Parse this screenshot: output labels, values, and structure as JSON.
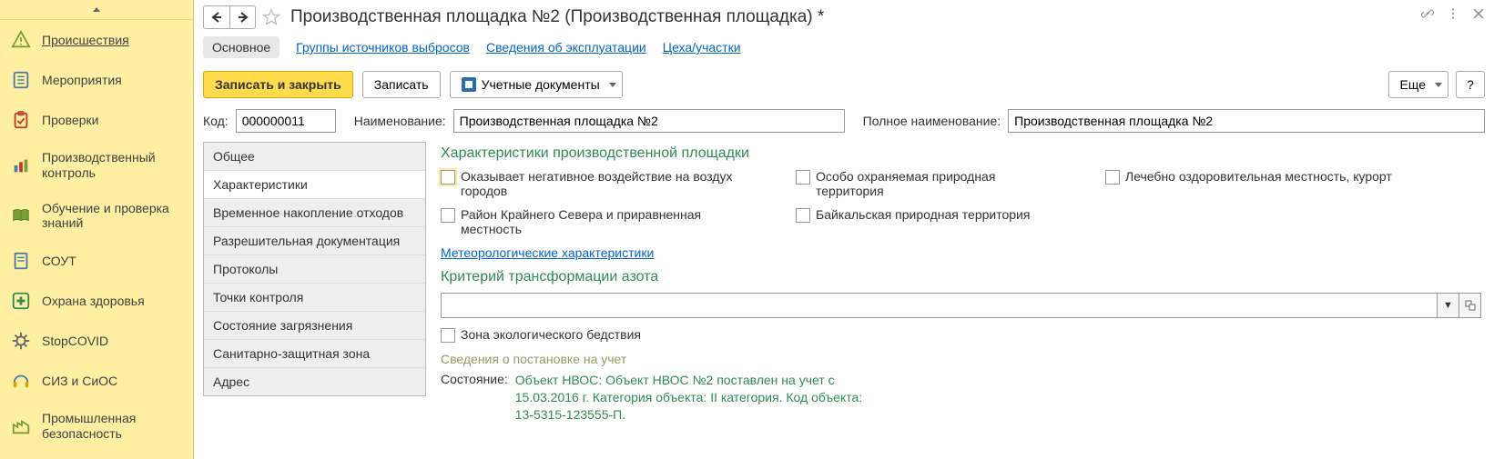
{
  "sidebar": {
    "items": [
      {
        "label": "Происшествия"
      },
      {
        "label": "Мероприятия"
      },
      {
        "label": "Проверки"
      },
      {
        "label": "Производственный контроль"
      },
      {
        "label": "Обучение и проверка знаний"
      },
      {
        "label": "СОУТ"
      },
      {
        "label": "Охрана здоровья"
      },
      {
        "label": "StopCOVID"
      },
      {
        "label": "СИЗ и СиОС"
      },
      {
        "label": "Промышленная безопасность"
      }
    ]
  },
  "header": {
    "title": "Производственная площадка №2 (Производственная площадка) *"
  },
  "tabs": [
    "Основное",
    "Группы источников выбросов",
    "Сведения об эксплуатации",
    "Цеха/участки"
  ],
  "toolbar": {
    "save_close": "Записать и закрыть",
    "save": "Записать",
    "docs": "Учетные документы",
    "more": "Еще",
    "help": "?"
  },
  "form": {
    "code_label": "Код:",
    "code_value": "000000011",
    "name_label": "Наименование:",
    "name_value": "Производственная площадка №2",
    "fullname_label": "Полное наименование:",
    "fullname_value": "Производственная площадка №2"
  },
  "vtabs": [
    "Общее",
    "Характеристики",
    "Временное накопление отходов",
    "Разрешительная документация",
    "Протоколы",
    "Точки контроля",
    "Состояние загрязнения",
    "Санитарно-защитная зона",
    "Адрес"
  ],
  "detail": {
    "section1": "Характеристики производственной площадки",
    "checks": {
      "c1": "Оказывает негативное воздействие на воздух городов",
      "c2": "Особо охраняемая природная территория",
      "c3": "Лечебно оздоровительная местность, курорт",
      "c4": "Район Крайнего Севера и приравненная местность",
      "c5": "Байкальская природная территория"
    },
    "meteo_link": "Метеорологические характеристики",
    "section2": "Критерий трансформации азота",
    "eco_disaster": "Зона экологического бедствия",
    "section3": "Сведения о постановке на учет",
    "status_label": "Состояние:",
    "status_value": "Объект НВОС: Объект НВОС №2 поставлен на учет с 15.03.2016 г. Категория объекта: II категория. Код объекта: 13-5315-123555-П."
  }
}
